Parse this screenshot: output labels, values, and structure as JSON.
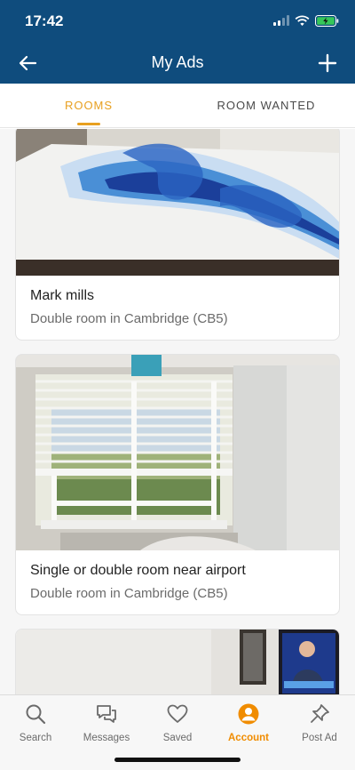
{
  "status": {
    "time": "17:42"
  },
  "header": {
    "title": "My Ads"
  },
  "tabs": [
    {
      "label": "ROOMS",
      "active": true
    },
    {
      "label": "ROOM WANTED",
      "active": false
    }
  ],
  "ads": [
    {
      "title": "Mark mills",
      "subtitle": "Double room in Cambridge (CB5)"
    },
    {
      "title": "Single or double room near airport",
      "subtitle": "Double room in Cambridge (CB5)"
    }
  ],
  "bottom_nav": [
    {
      "label": "Search",
      "icon": "search-icon"
    },
    {
      "label": "Messages",
      "icon": "messages-icon"
    },
    {
      "label": "Saved",
      "icon": "heart-icon"
    },
    {
      "label": "Account",
      "icon": "account-icon",
      "active": true
    },
    {
      "label": "Post Ad",
      "icon": "pin-icon"
    }
  ],
  "colors": {
    "header": "#0f4c7d",
    "accent": "#e8a020",
    "active_nav": "#f08c00"
  }
}
